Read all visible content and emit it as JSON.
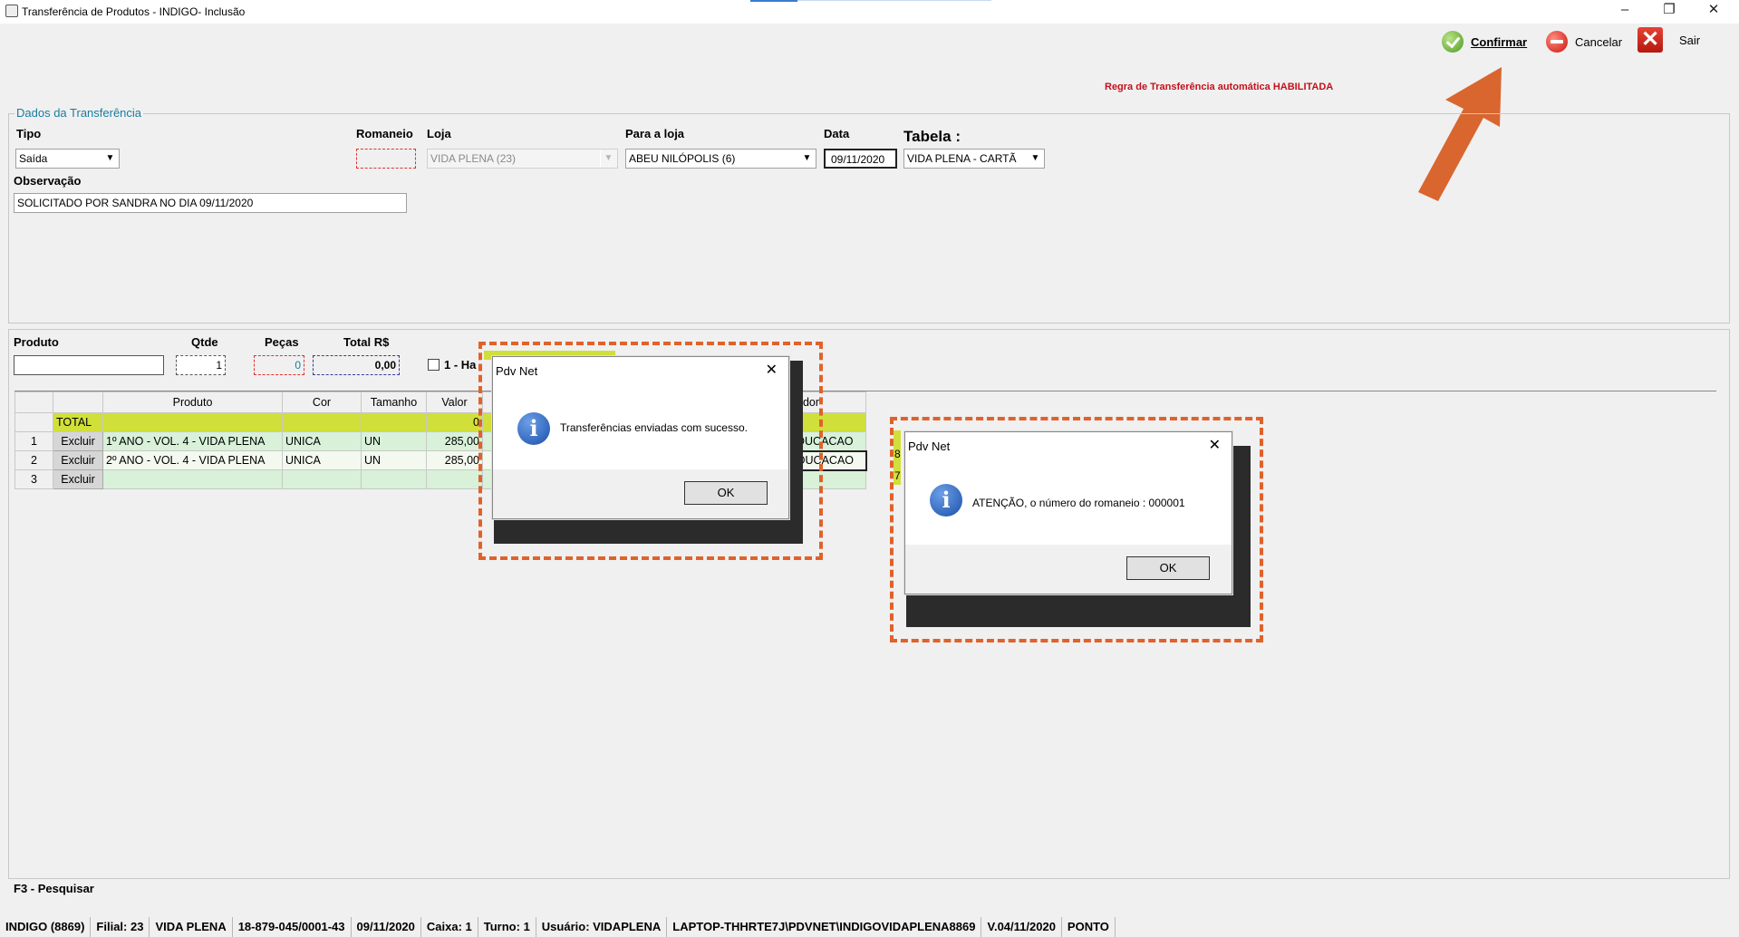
{
  "window": {
    "title": "Transferência de Produtos - INDIGO- Inclusão",
    "minimize_glyph": "–",
    "restore_glyph": "❐",
    "close_glyph": "✕"
  },
  "toolbar": {
    "confirm_label": "Confirmar",
    "cancel_label": "Cancelar",
    "exit_label": "Sair"
  },
  "rule_text": "Regra de Transferência automática HABILITADA",
  "dados": {
    "legend": "Dados da Transferência",
    "tipo_label": "Tipo",
    "tipo_value": "Saída",
    "romaneio_label": "Romaneio",
    "romaneio_value": "",
    "loja_label": "Loja",
    "loja_value": "VIDA PLENA (23)",
    "para_loja_label": "Para a loja",
    "para_loja_value": "ABEU NILÓPOLIS (6)",
    "data_label": "Data",
    "data_value": "09/11/2020",
    "tabela_label": "Tabela :",
    "tabela_value": "VIDA PLENA - CARTÃ",
    "observacao_label": "Observação",
    "observacao_value": "SOLICITADO POR SANDRA NO DIA 09/11/2020"
  },
  "produto_form": {
    "produto_label": "Produto",
    "produto_value": "",
    "qtde_label": "Qtde",
    "qtde_value": "1",
    "pecas_label": "Peças",
    "pecas_value": "0",
    "total_label": "Total R$",
    "total_value": "0,00",
    "checkbox_label": "1 - Ha"
  },
  "grid": {
    "headers": [
      "Produto",
      "Cor",
      "Tamanho",
      "Valor"
    ],
    "total_row_label": "TOTAL",
    "total_row_value": "0",
    "right_header_fragment": "edor",
    "rows": [
      {
        "num": "1",
        "action": "Excluir",
        "produto": "1º ANO - VOL. 4 - VIDA PLENA",
        "cor": "UNICA",
        "tamanho": "UN",
        "valor": "285,00",
        "vendedor": "DUCACAO"
      },
      {
        "num": "2",
        "action": "Excluir",
        "produto": "2º ANO - VOL. 4 - VIDA PLENA",
        "cor": "UNICA",
        "tamanho": "UN",
        "valor": "285,00",
        "vendedor": "DUCACAO"
      },
      {
        "num": "3",
        "action": "Excluir",
        "produto": "",
        "cor": "",
        "tamanho": "",
        "valor": "",
        "vendedor": ""
      }
    ],
    "behind_dialog_fragments": [
      "8",
      "7"
    ]
  },
  "hint": "F3 - Pesquisar",
  "dialog1": {
    "title": "Pdv Net",
    "message": "Transferências enviadas com sucesso.",
    "ok_label": "OK",
    "icon": "info-icon"
  },
  "dialog2": {
    "title": "Pdv Net",
    "message": "ATENÇÃO, o número do romaneio : 000001",
    "ok_label": "OK",
    "icon": "info-icon"
  },
  "statusbar": [
    "INDIGO (8869)",
    "Filial: 23",
    "VIDA PLENA",
    "18-879-045/0001-43",
    "09/11/2020",
    "Caixa: 1",
    "Turno: 1",
    "Usuário: VIDAPLENA",
    "LAPTOP-THHRTE7J\\PDVNET\\INDIGOVIDAPLENA8869",
    "V.04/11/2020",
    "PONTO"
  ],
  "colors": {
    "annotation_orange": "#e0622b",
    "total_row": "#d1df3a",
    "rule_text": "#c1121c",
    "group_legend": "#1a7ca0"
  }
}
